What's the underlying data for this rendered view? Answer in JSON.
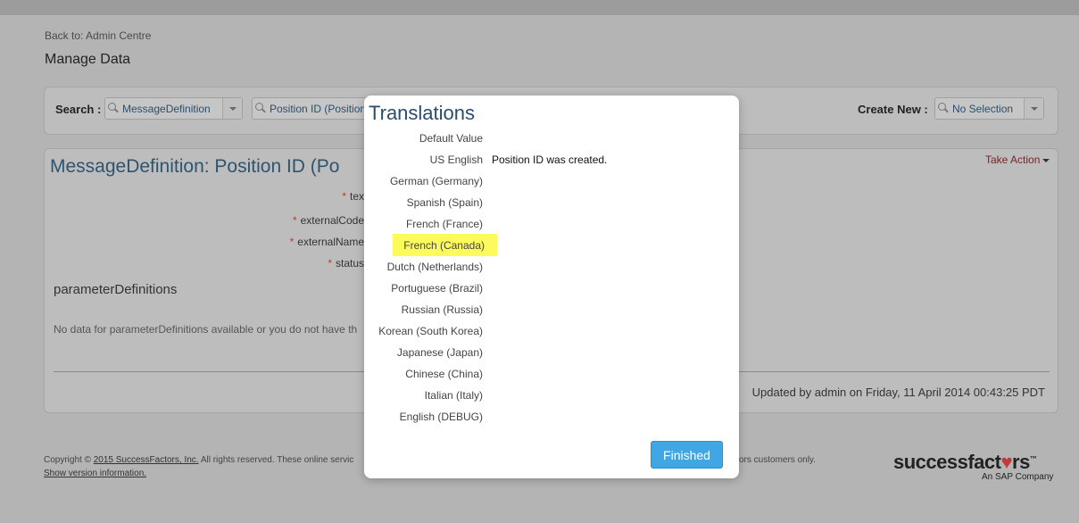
{
  "header": {
    "back_link": "Back to: Admin Centre",
    "page_title": "Manage Data"
  },
  "search": {
    "label": "Search :",
    "object_type": "MessageDefinition",
    "object_instance": "Position ID (Position",
    "create_label": "Create New :",
    "create_value": "No Selection"
  },
  "record": {
    "title": "MessageDefinition: Position ID (Po",
    "take_action": "Take Action",
    "fields": [
      {
        "label": "tex"
      },
      {
        "label": "externalCode"
      },
      {
        "label": "externalName"
      },
      {
        "label": "status"
      }
    ],
    "section_title": "parameterDefinitions",
    "no_data": "No data for parameterDefinitions available or you do not have th",
    "updated": "Updated by admin on Friday, 11 April 2014 00:43:25 PDT"
  },
  "modal": {
    "title": "Translations",
    "languages": [
      {
        "label": "Default Value",
        "value": ""
      },
      {
        "label": "US English",
        "value": "Position ID was created."
      },
      {
        "label": "German (Germany)",
        "value": ""
      },
      {
        "label": "Spanish (Spain)",
        "value": ""
      },
      {
        "label": "French (France)",
        "value": ""
      },
      {
        "label": "French (Canada)",
        "value": ""
      },
      {
        "label": "Dutch (Netherlands)",
        "value": ""
      },
      {
        "label": "Portuguese (Brazil)",
        "value": ""
      },
      {
        "label": "Russian (Russia)",
        "value": ""
      },
      {
        "label": "Korean (South Korea)",
        "value": ""
      },
      {
        "label": "Japanese (Japan)",
        "value": ""
      },
      {
        "label": "Chinese (China)",
        "value": ""
      },
      {
        "label": "Italian (Italy)",
        "value": ""
      },
      {
        "label": "English (DEBUG)",
        "value": ""
      }
    ],
    "highlighted_language": "French (Canada)",
    "finished_button": "Finished"
  },
  "footer": {
    "copyright_prefix": "Copyright ©",
    "copyright_link": "2015 SuccessFactors, Inc.",
    "copyright_rest": "All rights reserved. These online servic",
    "copyright_tail": "ors customers only.",
    "show_version": "Show version information.",
    "logo_text": "successfactors",
    "logo_sub": "An SAP Company"
  },
  "colors": {
    "highlight": "#fbfb5b",
    "button": "#40a7e5",
    "title_blue": "#2b4c6a",
    "take_action": "#7a2323"
  }
}
